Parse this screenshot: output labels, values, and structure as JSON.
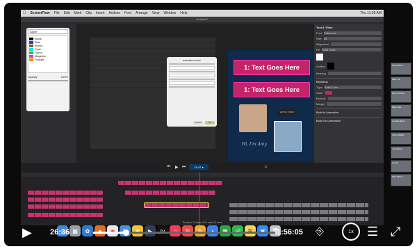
{
  "menubar": {
    "app_name": "ScreenFlow",
    "items": [
      "File",
      "Edit",
      "Mark",
      "Clip",
      "Insert",
      "Actions",
      "Font",
      "Arrange",
      "Help",
      "View",
      "Window",
      "Help"
    ],
    "clock": "Thu 11:28 AM"
  },
  "window_title": "Untitled 2",
  "colors_panel": {
    "selected_list": "Apple",
    "colors": [
      {
        "name": "Black",
        "hex": "#000000"
      },
      {
        "name": "Blue",
        "hex": "#1f3cff"
      },
      {
        "name": "Brown",
        "hex": "#8a5a2b"
      },
      {
        "name": "Cyan",
        "hex": "#00e5ff"
      },
      {
        "name": "Green",
        "hex": "#22c32a"
      },
      {
        "name": "Magenta",
        "hex": "#ff2bd6"
      },
      {
        "name": "Orange",
        "hex": "#ff8a00"
      }
    ],
    "opacity_label": "Opacity",
    "opacity_value": "100%"
  },
  "dialog": {
    "title": "Edit Redirect Rule",
    "cancel": "Cancel",
    "ok": "OK"
  },
  "video": {
    "banner_top": "1: Text Goes Here",
    "banner_bottom": "1: Text Goes Here",
    "pill": "WATCH VIDEO",
    "signature": "Hi, I'm Amy"
  },
  "inspector": {
    "title": "Text & Titles",
    "font_label": "Font",
    "font_value": "Fabio Ima",
    "size_label": "Size",
    "size_value": "60",
    "alignment_label": "Alignment",
    "fill_label": "Fill",
    "fill_value": "Solid Color",
    "outline_label": "Outline",
    "kerning_label": "Kerning",
    "backdrop_label": "Backdrop",
    "type_label": "Type",
    "type_value": "Solid Color",
    "color_label": "Color",
    "bounds_label": "Bounds",
    "margin_label": "Margin",
    "build_in": "Build In Animation",
    "build_out": "Build Out Animation"
  },
  "controls": {
    "timecode": "15:47 ●"
  },
  "timeline": {
    "duration_text": "Duration 19 secs of 19 mins 20 secs"
  },
  "participants": [
    "Tina Gainor",
    "Mary Ott",
    "Ryan Dorothy",
    "Mary Mae",
    "Jennifer Brian",
    "Anne Shaffer",
    "Joe Nelson",
    "Lisa M",
    "Paul Wilson"
  ],
  "dock_icons": [
    "finder-icon",
    "launchpad-icon",
    "safari-icon",
    "firefox-icon",
    "chrome-icon",
    "mail-icon",
    "photos-icon",
    "screenflow-icon",
    "apple-tv-icon",
    "music-icon",
    "news-icon",
    "pages-icon",
    "keynote-icon",
    "numbers-icon",
    "chat-icon",
    "notes-icon",
    "zoom-icon",
    "trash-icon"
  ],
  "player": {
    "elapsed": "26:36",
    "remaining": "1:56:05",
    "speed": "1x",
    "progress": 0.18
  }
}
